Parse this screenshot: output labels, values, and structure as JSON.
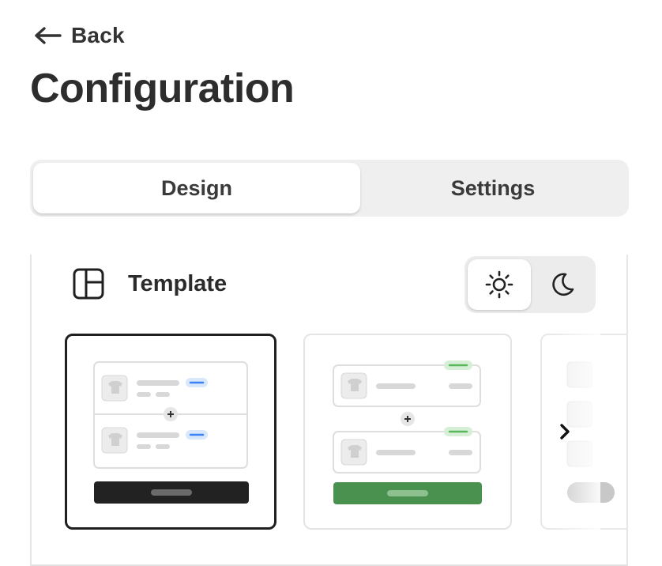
{
  "nav": {
    "back_label": "Back"
  },
  "page": {
    "title": "Configuration"
  },
  "tabs": [
    {
      "label": "Design",
      "active": true
    },
    {
      "label": "Settings",
      "active": false
    }
  ],
  "template_section": {
    "title": "Template",
    "icon": "layout-icon",
    "theme_modes": [
      {
        "name": "light",
        "icon": "sun-icon",
        "selected": true
      },
      {
        "name": "dark",
        "icon": "moon-icon",
        "selected": false
      }
    ],
    "templates": [
      {
        "selected": true,
        "badge_color": "#3b82f6",
        "button_color": "#222222"
      },
      {
        "selected": false,
        "badge_color": "#5cb85c",
        "button_color": "#4a9150"
      },
      {
        "selected": false,
        "partially_visible": true
      }
    ],
    "next_icon": "chevron-right-icon"
  }
}
